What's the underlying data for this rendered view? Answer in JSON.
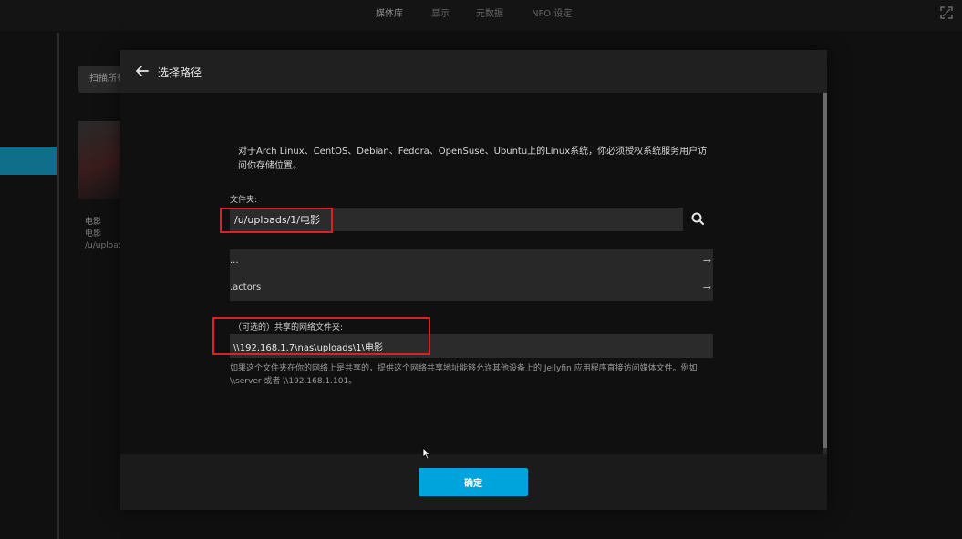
{
  "top_nav": {
    "tabs": [
      {
        "label": "媒体库",
        "active": true
      },
      {
        "label": "显示",
        "active": false
      },
      {
        "label": "元数据",
        "active": false
      },
      {
        "label": "NFO 设定",
        "active": false
      }
    ],
    "corner_icon": "fullscreen-icon"
  },
  "background": {
    "scan_button_label": "扫描所有",
    "library_card": {
      "name": "电影",
      "type": "电影",
      "path": "/u/uploads"
    }
  },
  "dialog": {
    "title": "选择路径",
    "back_icon": "arrow-left-icon",
    "notice": "对于Arch Linux、CentOS、Debian、Fedora、OpenSuse、Ubuntu上的Linux系统，你必须授权系统服务用户访问你存储位置。",
    "folder": {
      "label": "文件夹:",
      "value": "/u/uploads/1/电影",
      "search_icon": "search-icon"
    },
    "directory_list": [
      {
        "name": "...",
        "arrow": "→"
      },
      {
        "name": ".actors",
        "arrow": "→"
      }
    ],
    "network_share": {
      "label": "（可选的）共享的网络文件夹:",
      "value": "\\\\192.168.1.7\\nas\\uploads\\1\\电影",
      "help": "如果这个文件夹在你的网络上是共享的，提供这个网络共享地址能够允许其他设备上的 Jellyfin 应用程序直接访问媒体文件。例如 \\\\server 或者 \\\\192.168.1.101。"
    },
    "ok_button_label": "确定"
  },
  "colors": {
    "accent": "#00a4dc",
    "annotation": "#e02020",
    "background": "#101010"
  }
}
